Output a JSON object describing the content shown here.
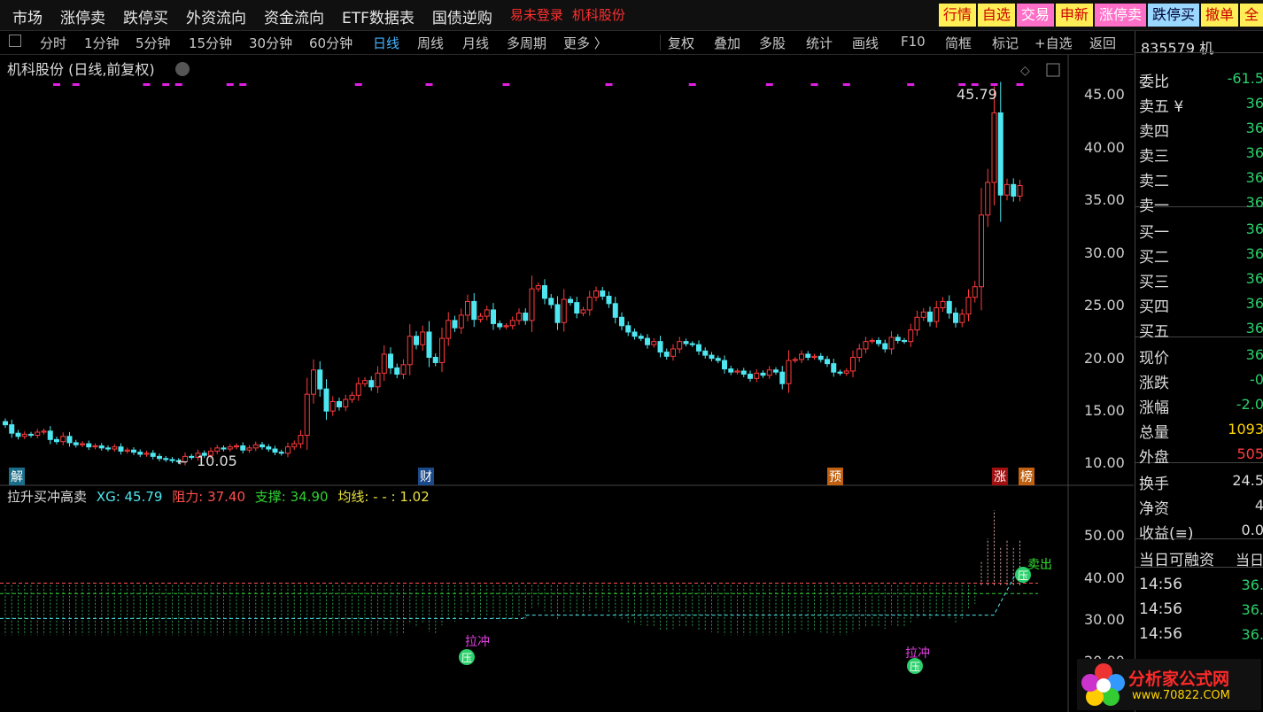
{
  "topmenu": [
    "市场",
    "涨停卖",
    "跌停买",
    "外资流向",
    "资金流向",
    "ETF数据表",
    "国债逆购"
  ],
  "topmenu_red": [
    "易未登录",
    "机科股份"
  ],
  "right_buttons": [
    {
      "label": "行情",
      "style": "yellow"
    },
    {
      "label": "自选",
      "style": "yellow"
    },
    {
      "label": "交易",
      "style": "pink"
    },
    {
      "label": "申新",
      "style": "yellow"
    },
    {
      "label": "涨停卖",
      "style": "pink"
    },
    {
      "label": "跌停买",
      "style": "blue"
    },
    {
      "label": "撤单",
      "style": "yellow"
    },
    {
      "label": "全",
      "style": "yellow"
    }
  ],
  "toolbar": {
    "periods": [
      "分时",
      "1分钟",
      "5分钟",
      "15分钟",
      "30分钟",
      "60分钟",
      "日线",
      "周线",
      "月线",
      "多周期",
      "更多 〉"
    ],
    "active": "日线",
    "tools": [
      "复权",
      "叠加",
      "多股",
      "统计",
      "画线",
      "F10",
      "简框",
      "标记",
      "+自选",
      "返回"
    ]
  },
  "chart_title": "机科股份 (日线,前复权)",
  "price_axis": [
    "45.00",
    "40.00",
    "35.00",
    "30.00",
    "25.00",
    "20.00",
    "15.00",
    "10.00"
  ],
  "max_label": "45.79",
  "min_label": "10.05",
  "event_tags": [
    {
      "text": "解",
      "color": "#1a6e8a"
    },
    {
      "text": "财",
      "color": "#1a4a8a"
    },
    {
      "text": "预",
      "color": "#c06010"
    },
    {
      "text": "涨",
      "color": "#a01010"
    },
    {
      "text": "榜",
      "color": "#c06010"
    }
  ],
  "indicator": {
    "name": "拉升买冲高卖",
    "xg": "XG: 45.79",
    "resist": "阻力: 37.40",
    "support": "支撑: 34.90",
    "avg": "均线: - - : 1.02",
    "axis": [
      "50.00",
      "40.00",
      "30.00",
      "20.00"
    ],
    "signals": {
      "sell": "卖出",
      "pressure": "压",
      "pull": "拉冲"
    }
  },
  "sidebar": {
    "code": "835579 机",
    "rows": [
      {
        "label": "委比",
        "value": "-61.5"
      },
      {
        "label": "卖五 ¥",
        "value": "36"
      },
      {
        "label": "卖四",
        "value": "36"
      },
      {
        "label": "卖三",
        "value": "36"
      },
      {
        "label": "卖二",
        "value": "36"
      },
      {
        "label": "卖一",
        "value": "36"
      },
      {
        "label": "买一",
        "value": "36"
      },
      {
        "label": "买二",
        "value": "36"
      },
      {
        "label": "买三",
        "value": "36"
      },
      {
        "label": "买四",
        "value": "36"
      },
      {
        "label": "买五",
        "value": "36"
      },
      {
        "label": "现价",
        "value": "36"
      },
      {
        "label": "涨跌",
        "value": "-0"
      },
      {
        "label": "涨幅",
        "value": "-2.0"
      },
      {
        "label": "总量",
        "value": "1093"
      },
      {
        "label": "外盘",
        "value": "505"
      },
      {
        "label": "换手",
        "value": "24.5"
      },
      {
        "label": "净资",
        "value": "4"
      },
      {
        "label": "收益(≡)",
        "value": "0.0"
      },
      {
        "label": "当日可融资",
        "value": "当日"
      },
      {
        "label": "14:56",
        "value": "36."
      },
      {
        "label": "14:56",
        "value": "36."
      },
      {
        "label": "14:56",
        "value": "36."
      }
    ]
  },
  "watermark": {
    "title": "分析家公式网",
    "url": "www.70822.COM"
  },
  "colors": {
    "up": "#ff3b3b",
    "down": "#4ee6f0",
    "grid": "#333333",
    "magenta": "#e020e0"
  },
  "chart_data": {
    "type": "candlestick",
    "closes": [
      13.6,
      12.8,
      12.5,
      12.7,
      12.6,
      12.9,
      13.0,
      12.2,
      12.0,
      12.5,
      11.9,
      11.7,
      11.8,
      11.5,
      11.6,
      11.4,
      11.3,
      11.5,
      11.1,
      11.2,
      11.0,
      10.8,
      10.9,
      10.6,
      10.4,
      10.3,
      10.2,
      10.1,
      10.6,
      10.5,
      10.9,
      10.7,
      11.1,
      11.4,
      11.3,
      11.5,
      11.6,
      11.2,
      11.4,
      11.7,
      11.5,
      11.3,
      11.0,
      10.9,
      11.5,
      11.8,
      12.6,
      16.5,
      18.8,
      17.0,
      14.9,
      15.8,
      15.3,
      16.0,
      16.4,
      17.5,
      17.8,
      17.2,
      18.5,
      20.3,
      19.0,
      18.4,
      19.3,
      22.0,
      21.2,
      22.4,
      20.0,
      19.5,
      21.8,
      23.5,
      22.8,
      24.0,
      25.3,
      23.6,
      23.9,
      24.5,
      23.2,
      22.9,
      23.0,
      23.5,
      24.2,
      23.5,
      26.5,
      26.8,
      25.6,
      25.0,
      23.3,
      25.5,
      25.2,
      24.2,
      24.5,
      25.7,
      26.3,
      25.8,
      25.1,
      23.8,
      23.0,
      22.4,
      22.0,
      21.8,
      21.2,
      21.5,
      20.5,
      20.1,
      20.8,
      21.5,
      21.3,
      21.2,
      20.6,
      20.2,
      19.9,
      19.7,
      18.9,
      18.6,
      18.7,
      18.4,
      18.0,
      18.5,
      18.3,
      18.8,
      18.6,
      17.5,
      19.7,
      19.8,
      20.3,
      20.0,
      20.1,
      19.8,
      19.4,
      18.6,
      18.5,
      18.7,
      20.0,
      20.8,
      21.5,
      21.6,
      21.3,
      20.8,
      21.9,
      21.6,
      21.5,
      22.6,
      23.8,
      24.3,
      23.4,
      24.7,
      25.3,
      24.2,
      23.3,
      24.1,
      25.7,
      26.7,
      33.5,
      36.6,
      43.2,
      35.4,
      36.4,
      35.3,
      36.3
    ]
  }
}
